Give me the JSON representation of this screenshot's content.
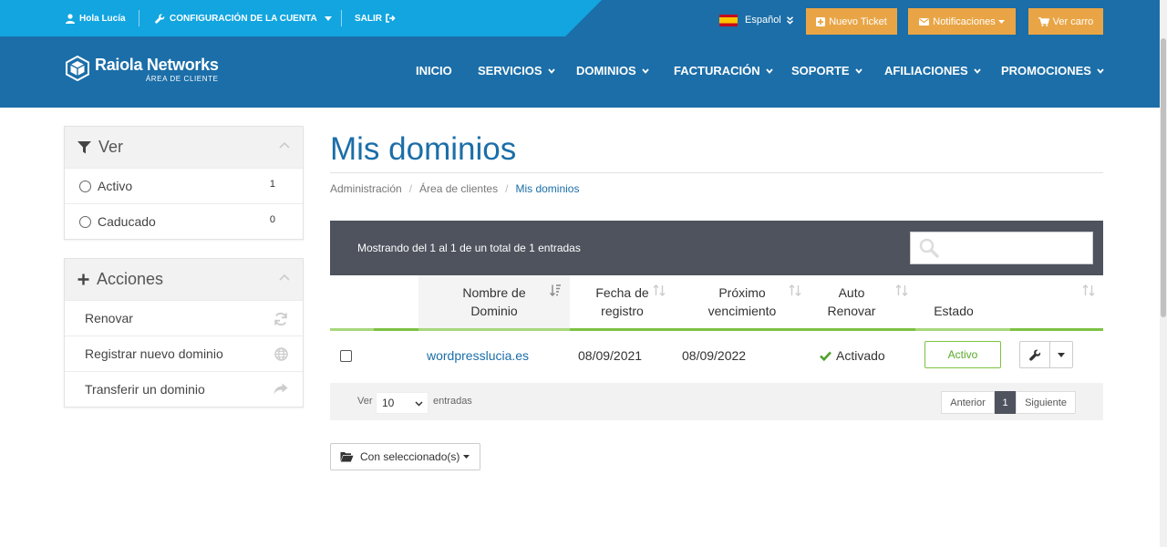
{
  "topbar": {
    "greeting": "Hola Lucía",
    "account": "CONFIGURACIÓN DE LA CUENTA",
    "logout": "SALIR",
    "language": "Español",
    "new_ticket": "Nuevo Ticket",
    "notifications": "Notificaciones",
    "cart": "Ver carro"
  },
  "brand": {
    "name": "Raiola Networks",
    "tagline": "ÁREA DE CLIENTE"
  },
  "nav": {
    "items": [
      "INICIO",
      "SERVICIOS",
      "DOMINIOS",
      "FACTURACIÓN",
      "SOPORTE",
      "AFILIACIONES",
      "PROMOCIONES"
    ]
  },
  "sidebar": {
    "filter_title": "Ver",
    "filters": [
      {
        "label": "Activo",
        "count": "1"
      },
      {
        "label": "Caducado",
        "count": "0"
      }
    ],
    "actions_title": "Acciones",
    "actions": [
      {
        "label": "Renovar",
        "icon": "refresh-icon"
      },
      {
        "label": "Registrar nuevo dominio",
        "icon": "globe-icon"
      },
      {
        "label": "Transferir un dominio",
        "icon": "share-icon"
      }
    ]
  },
  "main": {
    "title": "Mis dominios",
    "breadcrumb": [
      "Administración",
      "Área de clientes",
      "Mis dominios"
    ],
    "table": {
      "summary": "Mostrando del 1 al 1 de un total de 1 entradas",
      "search_placeholder": "",
      "columns": [
        {
          "line1": "Nombre de",
          "line2": "Dominio"
        },
        {
          "line1": "Fecha de",
          "line2": "registro"
        },
        {
          "line1": "Próximo",
          "line2": "vencimiento"
        },
        {
          "line1": "Auto",
          "line2": "Renovar"
        },
        {
          "line1": "Estado",
          "line2": ""
        }
      ],
      "rows": [
        {
          "domain": "wordpresslucia.es",
          "registered": "08/09/2021",
          "expires": "08/09/2022",
          "auto_renew": "Activado",
          "status": "Activo"
        }
      ],
      "footer": {
        "show_label": "Ver",
        "page_size": "10",
        "entries_label": "entradas",
        "prev": "Anterior",
        "page": "1",
        "next": "Siguiente"
      }
    },
    "bulk_action": "Con seleccionado(s)"
  },
  "colors": {
    "primary": "#1b6ea8",
    "topbar_accent": "#12a5e0",
    "button_yellow": "#e9a545",
    "success": "#7dc243",
    "table_header": "#4e535e"
  }
}
